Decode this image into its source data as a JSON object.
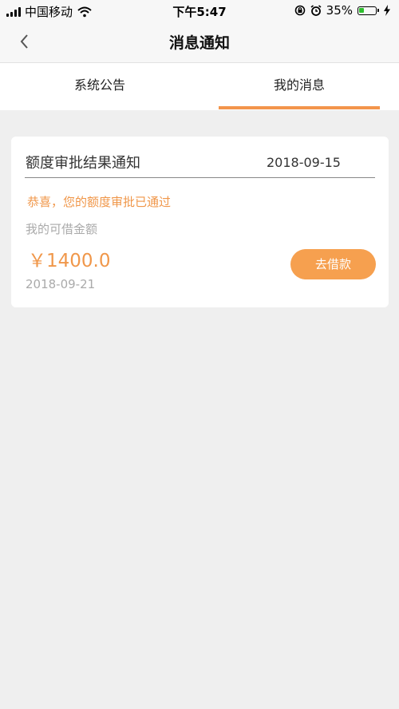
{
  "status_bar": {
    "carrier": "中国移动",
    "time": "下午5:47",
    "battery_percent": "35%",
    "battery_level": 0.35,
    "icons": [
      "signal-icon",
      "wifi-icon",
      "rotation-lock-icon",
      "alarm-icon",
      "battery-icon",
      "charging-icon"
    ]
  },
  "nav": {
    "title": "消息通知",
    "back_icon": "chevron-left-icon"
  },
  "tabs": [
    {
      "label": "系统公告",
      "active": false
    },
    {
      "label": "我的消息",
      "active": true
    }
  ],
  "message": {
    "title": "额度审批结果通知",
    "date": "2018-09-15",
    "congrats_text": "恭喜，您的额度审批已通过",
    "amount_label": "我的可借金额",
    "amount_value": "￥1400.0",
    "message_date": "2018-09-21",
    "action_label": "去借款"
  },
  "colors": {
    "accent": "#f3954b",
    "button": "#f6a04f",
    "page_background": "#efefef",
    "battery": "#2ebf2e"
  }
}
